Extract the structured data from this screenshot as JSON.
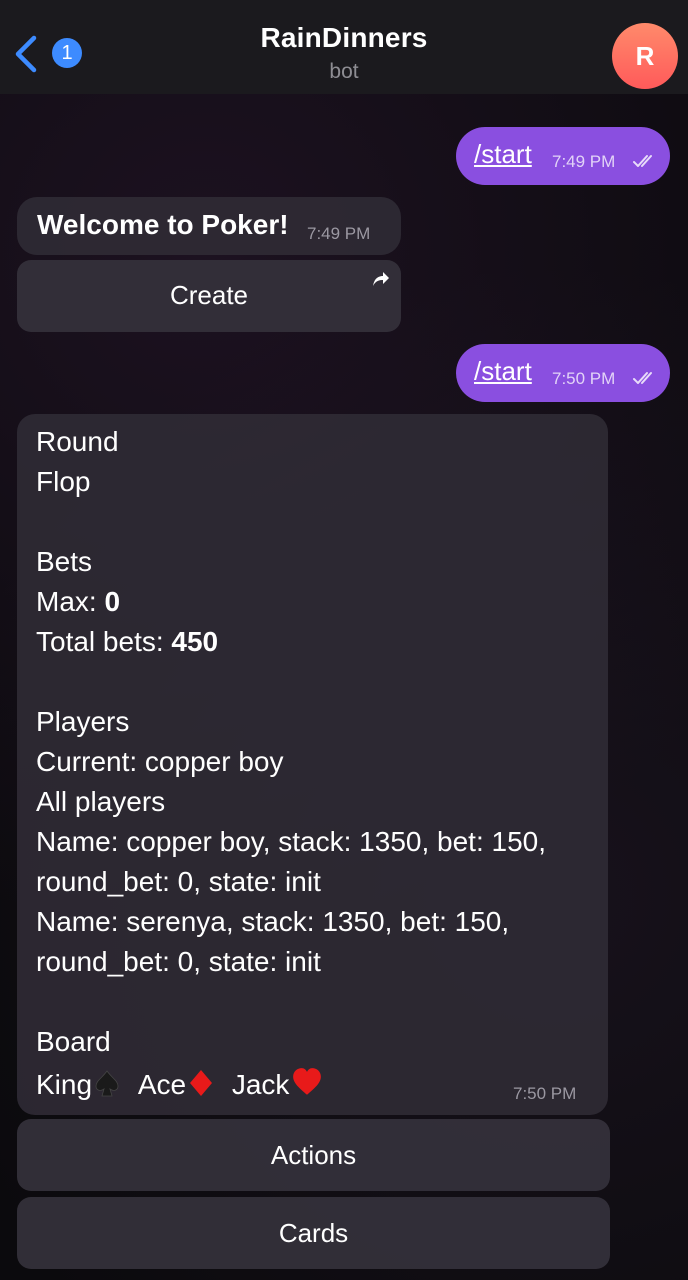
{
  "header": {
    "back_badge": "1",
    "title": "RainDinners",
    "subtitle": "bot",
    "avatar_letter": "R"
  },
  "messages": {
    "out1": {
      "text": "/start",
      "time": "7:49 PM"
    },
    "welcome": {
      "text": "Welcome to Poker!",
      "time": "7:49 PM",
      "button": "Create"
    },
    "out2": {
      "text": "/start",
      "time": "7:50 PM"
    },
    "status": {
      "round_heading": "Round",
      "round_value": "Flop",
      "bets_heading": "Bets",
      "max_label": "Max: ",
      "max_value": "0",
      "total_label": "Total bets: ",
      "total_value": "450",
      "players_heading": "Players",
      "current": "Current: copper boy",
      "all_players": "All players",
      "player1_line1": "Name: copper boy, stack: 1350, bet: 150,",
      "player1_line2": "round_bet: 0, state: init",
      "player2_line1": "Name: serenya, stack: 1350, bet: 150,",
      "player2_line2": "round_bet: 0, state: init",
      "board_heading": "Board",
      "card1": "King",
      "card2": "Ace",
      "card3": "Jack",
      "time": "7:50 PM"
    },
    "buttons": {
      "actions": "Actions",
      "cards": "Cards"
    }
  },
  "colors": {
    "outgoing_bubble": "#8a4fe0",
    "incoming_bubble": "#2f2a34",
    "badge": "#3d8bff",
    "back_arrow": "#3d8bff"
  },
  "icons": [
    "chevron-left-icon",
    "forward-arrow-icon",
    "double-check-icon",
    "spade-icon",
    "diamond-icon",
    "heart-icon"
  ]
}
